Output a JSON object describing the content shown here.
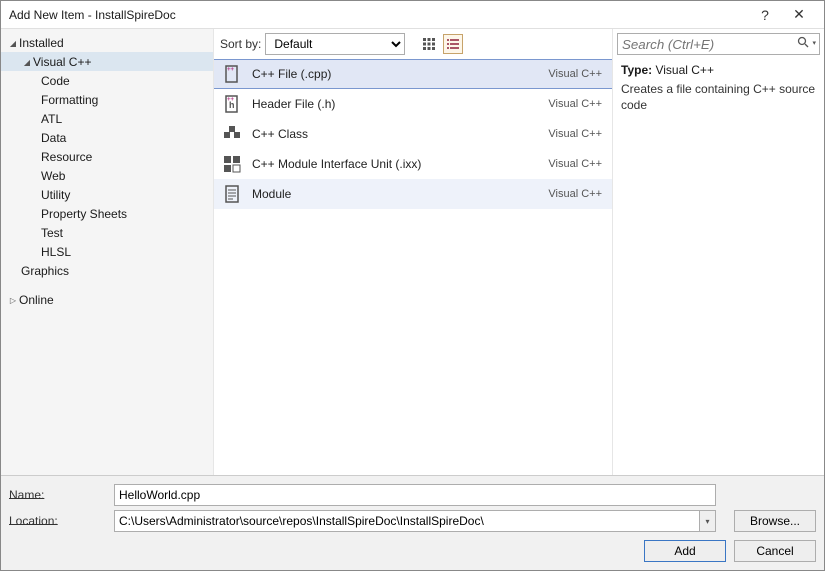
{
  "title": "Add New Item - InstallSpireDoc",
  "sidebar": {
    "installed": "Installed",
    "visual_cpp": "Visual C++",
    "sub": [
      "Code",
      "Formatting",
      "ATL",
      "Data",
      "Resource",
      "Web",
      "Utility",
      "Property Sheets",
      "Test",
      "HLSL"
    ],
    "graphics": "Graphics",
    "online": "Online"
  },
  "toolbar": {
    "sortby_label": "Sort by:",
    "sort_value": "Default"
  },
  "templates": [
    {
      "label": "C++ File (.cpp)",
      "tag": "Visual C++",
      "icon": "cpp-file-icon",
      "selected": true
    },
    {
      "label": "Header File (.h)",
      "tag": "Visual C++",
      "icon": "header-file-icon",
      "selected": false
    },
    {
      "label": "C++ Class",
      "tag": "Visual C++",
      "icon": "cpp-class-icon",
      "selected": false
    },
    {
      "label": "C++ Module Interface Unit (.ixx)",
      "tag": "Visual C++",
      "icon": "module-unit-icon",
      "selected": false
    },
    {
      "label": "Module",
      "tag": "Visual C++",
      "icon": "module-icon",
      "selected": false,
      "hover": true
    }
  ],
  "search": {
    "placeholder": "Search (Ctrl+E)"
  },
  "details": {
    "type_label": "Type:",
    "type_value": "Visual C++",
    "description": "Creates a file containing C++ source code"
  },
  "footer": {
    "name_label": "Name:",
    "name_value": "HelloWorld.cpp",
    "location_label": "Location:",
    "location_value": "C:\\Users\\Administrator\\source\\repos\\InstallSpireDoc\\InstallSpireDoc\\",
    "browse": "Browse...",
    "add": "Add",
    "cancel": "Cancel"
  }
}
